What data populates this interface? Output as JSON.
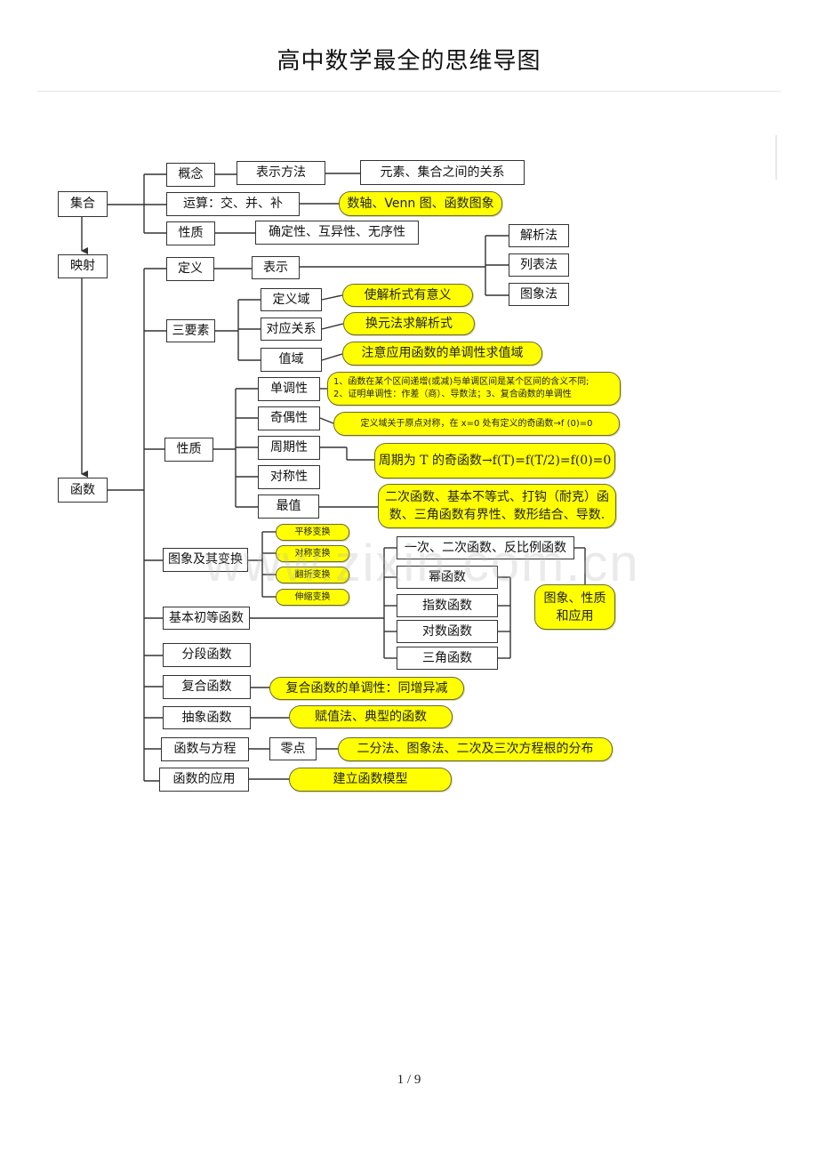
{
  "page": {
    "title": "高中数学最全的思维导图",
    "footer": "1  / 9",
    "watermark": "www.zixin.com.cn"
  },
  "colors": {
    "node_fill": "#ffffff",
    "highlight_fill": "#ffff00",
    "line": "#333333"
  },
  "mindmap": {
    "nodes": {
      "jihe": "集合",
      "yingshe": "映射",
      "hanshu": "函数",
      "gainian": "概念",
      "biaoshifangfa": "表示方法",
      "yuansu_guanxi": "元素、集合之间的关系",
      "yunsuan": "运算：交、并、补",
      "yunsuan_note": "数轴、Venn 图、函数图象",
      "xingzhi_set": "性质",
      "xingzhi_set_note": "确定性、互异性、无序性",
      "dingyi": "定义",
      "biaoshi": "表示",
      "jiexifa": "解析法",
      "liebiaofa": "列表法",
      "tuxiangfa": "图象法",
      "sanyaosu": "三要素",
      "dingyiyu": "定义域",
      "dingyiyu_note": "使解析式有意义",
      "duiying": "对应关系",
      "duiying_note": "换元法求解析式",
      "zhiyu": "值域",
      "zhiyu_note": "注意应用函数的单调性求值域",
      "xingzhi_fn": "性质",
      "dandiao": "单调性",
      "dandiao_note_1": "1、函数在某个区间递增(或减)与单调区间是某个区间的含义不同;",
      "dandiao_note_2": "2、证明单调性：作差（商）、导数法；3、复合函数的单调性",
      "qiou": "奇偶性",
      "qiou_note": "定义域关于原点对称，在 x=0 处有定义的奇函数→f (0)=0",
      "zhouqi": "周期性",
      "zhouqi_note": "周期为 T 的奇函数→f(T)=f(T/2)=f(0)=0",
      "duichen": "对称性",
      "zuizhi": "最值",
      "zuizhi_note": "二次函数、基本不等式、打钩（耐克）函数、三角函数有界性、数形结合、导数.",
      "tuxiang_bianhuan": "图象及其变换",
      "pingyi": "平移变换",
      "duichen_bh": "对称变换",
      "fanzhe": "翻折变换",
      "shensuo": "伸缩变换",
      "jiben_chudeng": "基本初等函数",
      "yici_erci": "一次、二次函数、反比例函数",
      "mi": "幂函数",
      "zhishu": "指数函数",
      "duishu": "对数函数",
      "sanjiao": "三角函数",
      "tuxiang_xingzhi": "图象、性质和应用",
      "fenduan": "分段函数",
      "fuhe": "复合函数",
      "fuhe_note": "复合函数的单调性：同增异减",
      "chouxiang": "抽象函数",
      "chouxiang_note": "赋值法、典型的函数",
      "fangcheng": "函数与方程",
      "lingdian": "零点",
      "lingdian_note": "二分法、图象法、二次及三次方程根的分布",
      "yingyong": "函数的应用",
      "yingyong_note": "建立函数模型"
    }
  }
}
